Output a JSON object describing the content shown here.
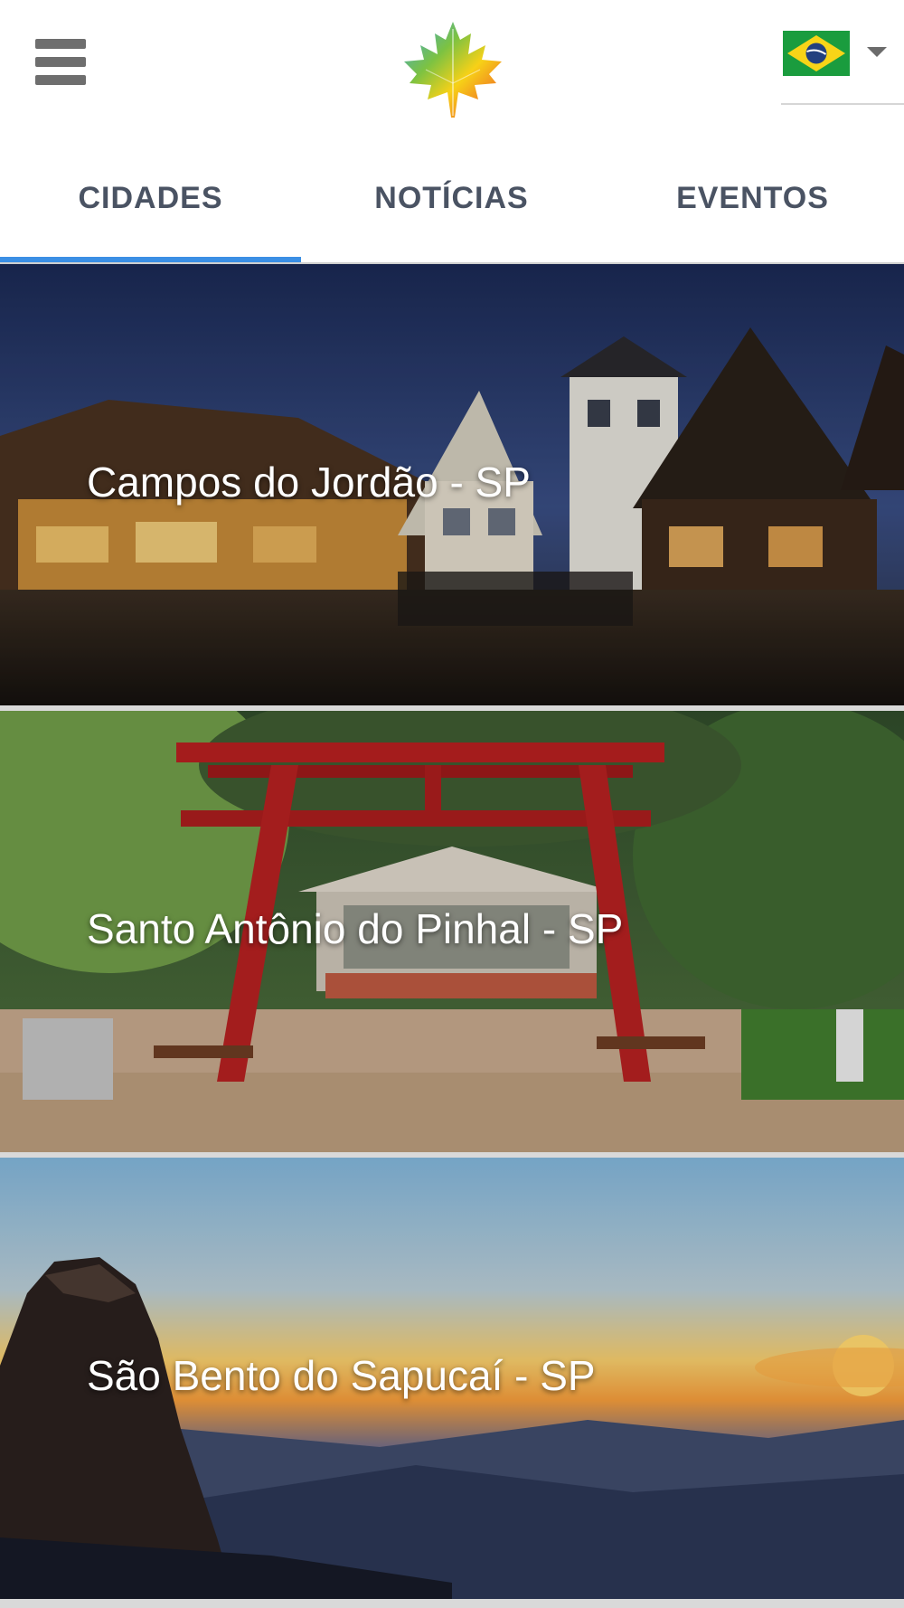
{
  "header": {
    "menu_icon": "hamburger-menu-icon",
    "logo_icon": "maple-leaf-logo-icon",
    "language": {
      "flag_icon": "brazil-flag-icon",
      "dropdown_icon": "caret-down-icon"
    }
  },
  "tabs": [
    {
      "label": "CIDADES",
      "active": true
    },
    {
      "label": "NOTÍCIAS",
      "active": false
    },
    {
      "label": "EVENTOS",
      "active": false
    }
  ],
  "colors": {
    "tab_text": "#4a5363",
    "tab_indicator": "#3b8fe4"
  },
  "cities": [
    {
      "name": "Campos do Jordão - SP"
    },
    {
      "name": "Santo Antônio do Pinhal - SP"
    },
    {
      "name": "São Bento do Sapucaí - SP"
    }
  ]
}
